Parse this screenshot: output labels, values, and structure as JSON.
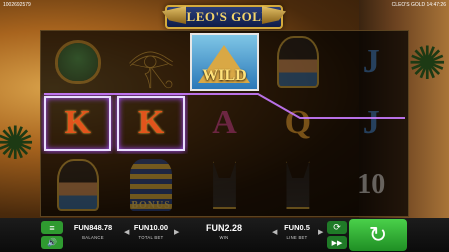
{
  "top": {
    "game_id": "1002692579",
    "clock": "CLEO'S GOLD 14:47:26"
  },
  "logo": {
    "title": "CLEO'S GOLD"
  },
  "reels": [
    [
      {
        "symbol": "scarab",
        "label": ""
      },
      {
        "symbol": "eye-of-horus",
        "label": ""
      },
      {
        "symbol": "wild",
        "label": "WILD"
      },
      {
        "symbol": "cleopatra",
        "label": ""
      },
      {
        "symbol": "J",
        "label": "J"
      }
    ],
    [
      {
        "symbol": "K",
        "label": "K"
      },
      {
        "symbol": "K",
        "label": "K"
      },
      {
        "symbol": "A",
        "label": "A"
      },
      {
        "symbol": "Q",
        "label": "Q"
      },
      {
        "symbol": "J",
        "label": "J"
      }
    ],
    [
      {
        "symbol": "cleopatra",
        "label": ""
      },
      {
        "symbol": "pharaoh-bonus",
        "label": "BONUS"
      },
      {
        "symbol": "anubis",
        "label": ""
      },
      {
        "symbol": "anubis",
        "label": ""
      },
      {
        "symbol": "10",
        "label": "10"
      }
    ]
  ],
  "bottom": {
    "balance": {
      "value": "FUN848.78",
      "label": "BALANCE"
    },
    "total_bet": {
      "value": "FUN10.00",
      "label": "TOTAL BET"
    },
    "win": {
      "value": "FUN2.28",
      "label": "WIN"
    },
    "line_bet": {
      "value": "FUN0.5",
      "label": "LINE BET"
    }
  },
  "colors": {
    "win_highlight": "#a64cff",
    "spin_button": "#2fb834"
  }
}
